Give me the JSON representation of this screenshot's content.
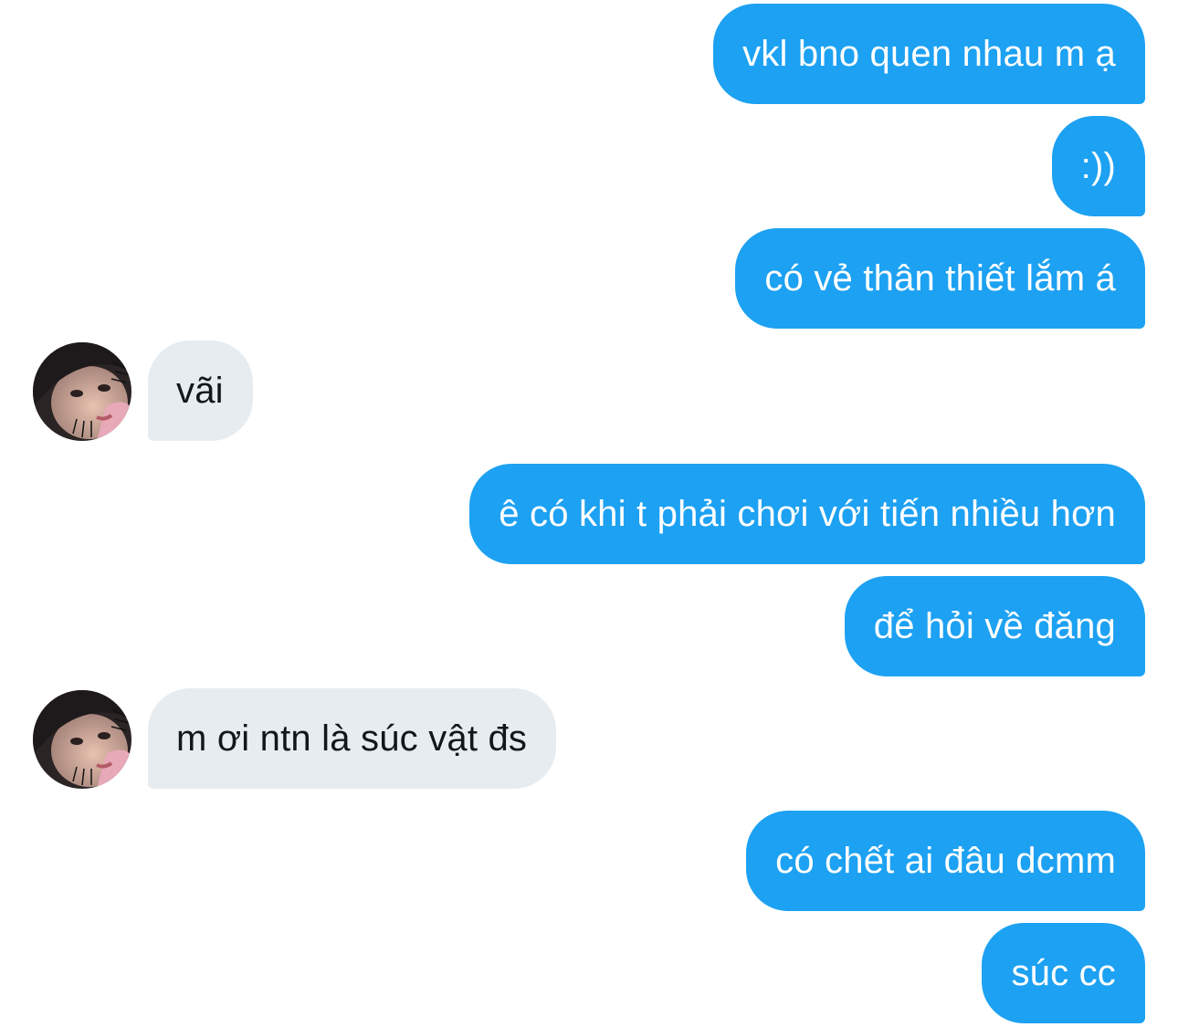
{
  "conversation": {
    "messages": [
      {
        "direction": "outgoing",
        "text": "vkl bno quen nhau m ạ"
      },
      {
        "direction": "outgoing",
        "text": ":))"
      },
      {
        "direction": "outgoing",
        "text": "có vẻ thân thiết lắm á"
      },
      {
        "direction": "incoming",
        "text": "vãi",
        "avatar_icon": "user-avatar-icon"
      },
      {
        "direction": "outgoing",
        "text": "ê có khi t phải chơi với tiến nhiều hơn"
      },
      {
        "direction": "outgoing",
        "text": "để hỏi về đăng"
      },
      {
        "direction": "incoming",
        "text": "m ơi ntn là súc vật đs",
        "avatar_icon": "user-avatar-icon"
      },
      {
        "direction": "outgoing",
        "text": "có chết ai đâu dcmm"
      },
      {
        "direction": "outgoing",
        "text": "súc cc"
      }
    ]
  },
  "colors": {
    "outgoing_bubble": "#1da1f2",
    "outgoing_text": "#ffffff",
    "incoming_bubble": "#e6ecf0",
    "incoming_text": "#14171a"
  }
}
